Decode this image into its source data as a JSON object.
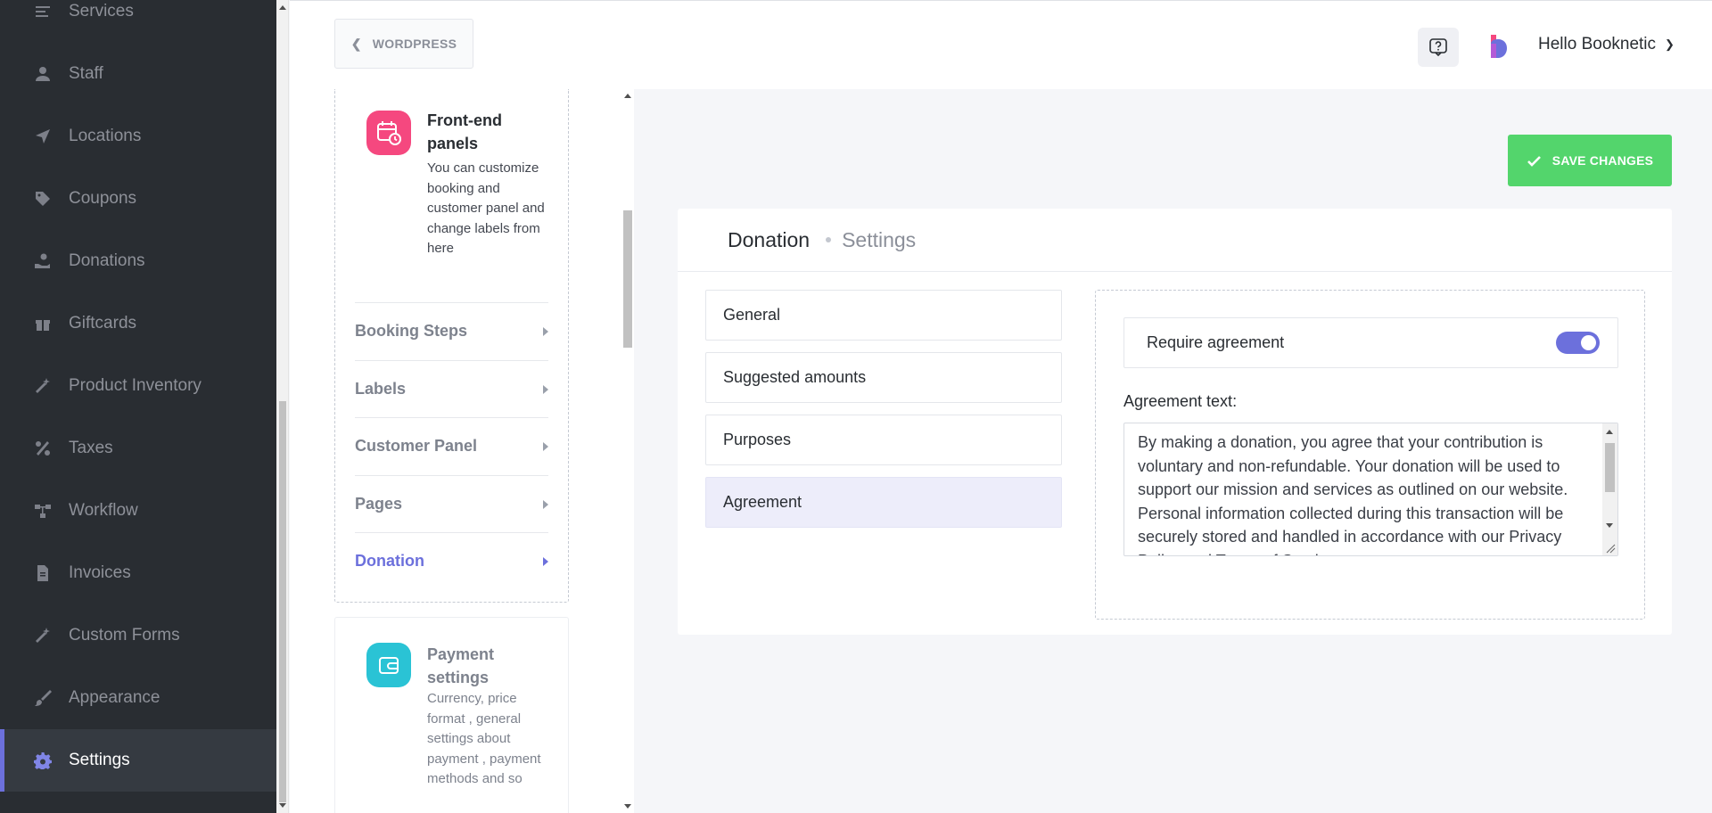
{
  "sidebar": {
    "items": [
      {
        "label": "Services",
        "icon": "list-icon"
      },
      {
        "label": "Staff",
        "icon": "user-icon"
      },
      {
        "label": "Locations",
        "icon": "location-arrow-icon"
      },
      {
        "label": "Coupons",
        "icon": "tag-icon"
      },
      {
        "label": "Donations",
        "icon": "hand-heart-icon"
      },
      {
        "label": "Giftcards",
        "icon": "gift-icon"
      },
      {
        "label": "Product Inventory",
        "icon": "magic-wand-icon"
      },
      {
        "label": "Taxes",
        "icon": "percent-icon"
      },
      {
        "label": "Workflow",
        "icon": "workflow-icon"
      },
      {
        "label": "Invoices",
        "icon": "file-icon"
      },
      {
        "label": "Custom Forms",
        "icon": "magic-wand-icon"
      },
      {
        "label": "Appearance",
        "icon": "brush-icon"
      },
      {
        "label": "Settings",
        "icon": "gear-icon",
        "active": true
      }
    ]
  },
  "header": {
    "wordpress_label": "WORDPRESS",
    "greeting": "Hello Booknetic"
  },
  "settings_nav": {
    "frontend": {
      "title": "Front-end panels",
      "description": "You can customize booking and customer panel and change labels from here",
      "items": [
        {
          "label": "Booking Steps"
        },
        {
          "label": "Labels"
        },
        {
          "label": "Customer Panel"
        },
        {
          "label": "Pages"
        },
        {
          "label": "Donation",
          "active": true
        }
      ]
    },
    "payment": {
      "title": "Payment settings",
      "description": "Currency, price format , general settings about payment , payment methods and so"
    }
  },
  "toolbar": {
    "save_label": "SAVE CHANGES"
  },
  "content": {
    "breadcrumb_main": "Donation",
    "breadcrumb_sub": "Settings",
    "tabs": [
      {
        "label": "General"
      },
      {
        "label": "Suggested amounts"
      },
      {
        "label": "Purposes"
      },
      {
        "label": "Agreement",
        "active": true
      }
    ],
    "agreement": {
      "require_label": "Require agreement",
      "require_enabled": true,
      "text_label": "Agreement text:",
      "text_value": "By making a donation, you agree that your contribution is voluntary and non-refundable. Your donation will be used to support our mission and services as outlined on our website. Personal information collected during this transaction will be securely stored and handled in accordance with our Privacy Policy and Terms of Service."
    }
  },
  "colors": {
    "sidebar_bg": "#292d32",
    "accent": "#6c70dc",
    "save_green": "#53d56c",
    "frontend_icon": "#f5487f",
    "payment_icon": "#2ac3d5"
  }
}
